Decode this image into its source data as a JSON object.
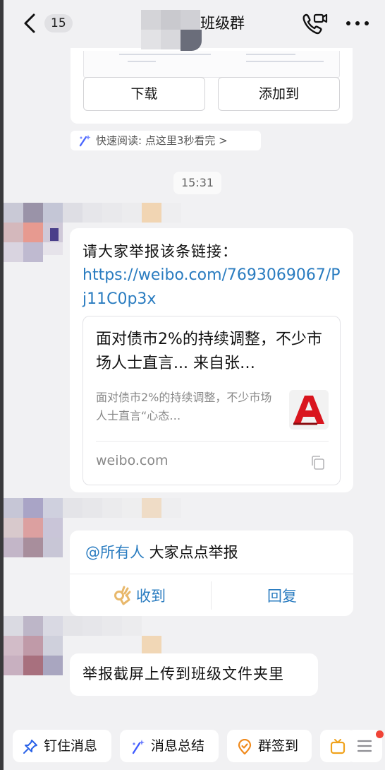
{
  "header": {
    "unread_count": "15",
    "title": "班级群"
  },
  "file_card": {
    "download_label": "下载",
    "add_to_label": "添加到"
  },
  "quick_read": {
    "label": "快速阅读: 点这里3秒看完 >"
  },
  "timestamp": "15:31",
  "messages": [
    {
      "text": "请大家举报该条链接：",
      "link": "https://weibo.com/7693069067/Pj11C0p3x",
      "link_card": {
        "title": "面对债市2%的持续调整，不少市场人士直言... 来自张…",
        "description": "面对债市2%的持续调整，不少市场人士直言“心态…",
        "domain": "weibo.com"
      }
    },
    {
      "mention": "@所有人",
      "text": " 大家点点举报",
      "action_ack": "收到",
      "action_reply": "回复"
    },
    {
      "text": "举报截屏上传到班级文件夹里"
    }
  ],
  "bottom_bar": {
    "chips": [
      "钉住消息",
      "消息总结",
      "群签到"
    ]
  },
  "colors": {
    "link": "#2a7cc0",
    "background": "#f1f1f3",
    "badge_red": "#f04437"
  }
}
